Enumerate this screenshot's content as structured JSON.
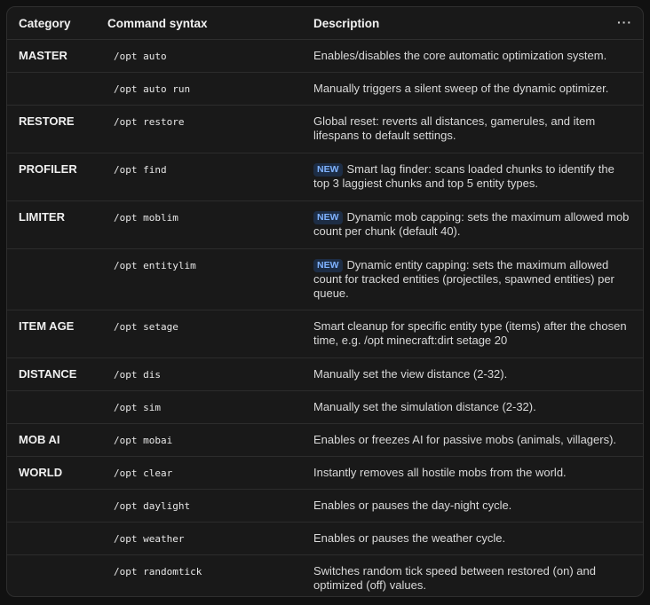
{
  "header": {
    "category": "Category",
    "syntax": "Command syntax",
    "description": "Description",
    "more_icon": "ellipsis-icon",
    "more_glyph": "···"
  },
  "badge_label": "NEW",
  "rows": [
    {
      "category": "MASTER",
      "command": "/opt auto",
      "new": false,
      "description": "Enables/disables the core automatic optimization system."
    },
    {
      "category": "",
      "command": "/opt auto run",
      "new": false,
      "description": "Manually triggers a silent sweep of the dynamic optimizer."
    },
    {
      "category": "RESTORE",
      "command": "/opt restore",
      "new": false,
      "description": "Global reset: reverts all distances, gamerules, and item lifespans to default settings."
    },
    {
      "category": "PROFILER",
      "command": "/opt find",
      "new": true,
      "description": "Smart lag finder: scans loaded chunks to identify the top 3 laggiest chunks and top 5 entity types."
    },
    {
      "category": "LIMITER",
      "command": "/opt moblim",
      "new": true,
      "description": "Dynamic mob capping: sets the maximum allowed mob count per chunk (default 40)."
    },
    {
      "category": "",
      "command": "/opt entitylim",
      "new": true,
      "description": "Dynamic entity capping: sets the maximum allowed count for tracked entities (projectiles, spawned entities) per queue."
    },
    {
      "category": "ITEM AGE",
      "command": "/opt setage",
      "new": false,
      "description": "Smart cleanup for specific entity type (items) after the chosen time, e.g. /opt minecraft:dirt setage 20"
    },
    {
      "category": "DISTANCE",
      "command": "/opt dis",
      "new": false,
      "description": "Manually set the view distance (2-32)."
    },
    {
      "category": "",
      "command": "/opt sim",
      "new": false,
      "description": "Manually set the simulation distance (2-32)."
    },
    {
      "category": "MOB AI",
      "command": "/opt mobai",
      "new": false,
      "description": "Enables or freezes AI for passive mobs (animals, villagers)."
    },
    {
      "category": "WORLD",
      "command": "/opt clear",
      "new": false,
      "description": "Instantly removes all hostile mobs from the world."
    },
    {
      "category": "",
      "command": "/opt daylight",
      "new": false,
      "description": "Enables or pauses the day-night cycle."
    },
    {
      "category": "",
      "command": "/opt weather",
      "new": false,
      "description": "Enables or pauses the weather cycle."
    },
    {
      "category": "",
      "command": "/opt randomtick",
      "new": false,
      "description": "Switches random tick speed between restored (on) and optimized (off) values."
    }
  ]
}
